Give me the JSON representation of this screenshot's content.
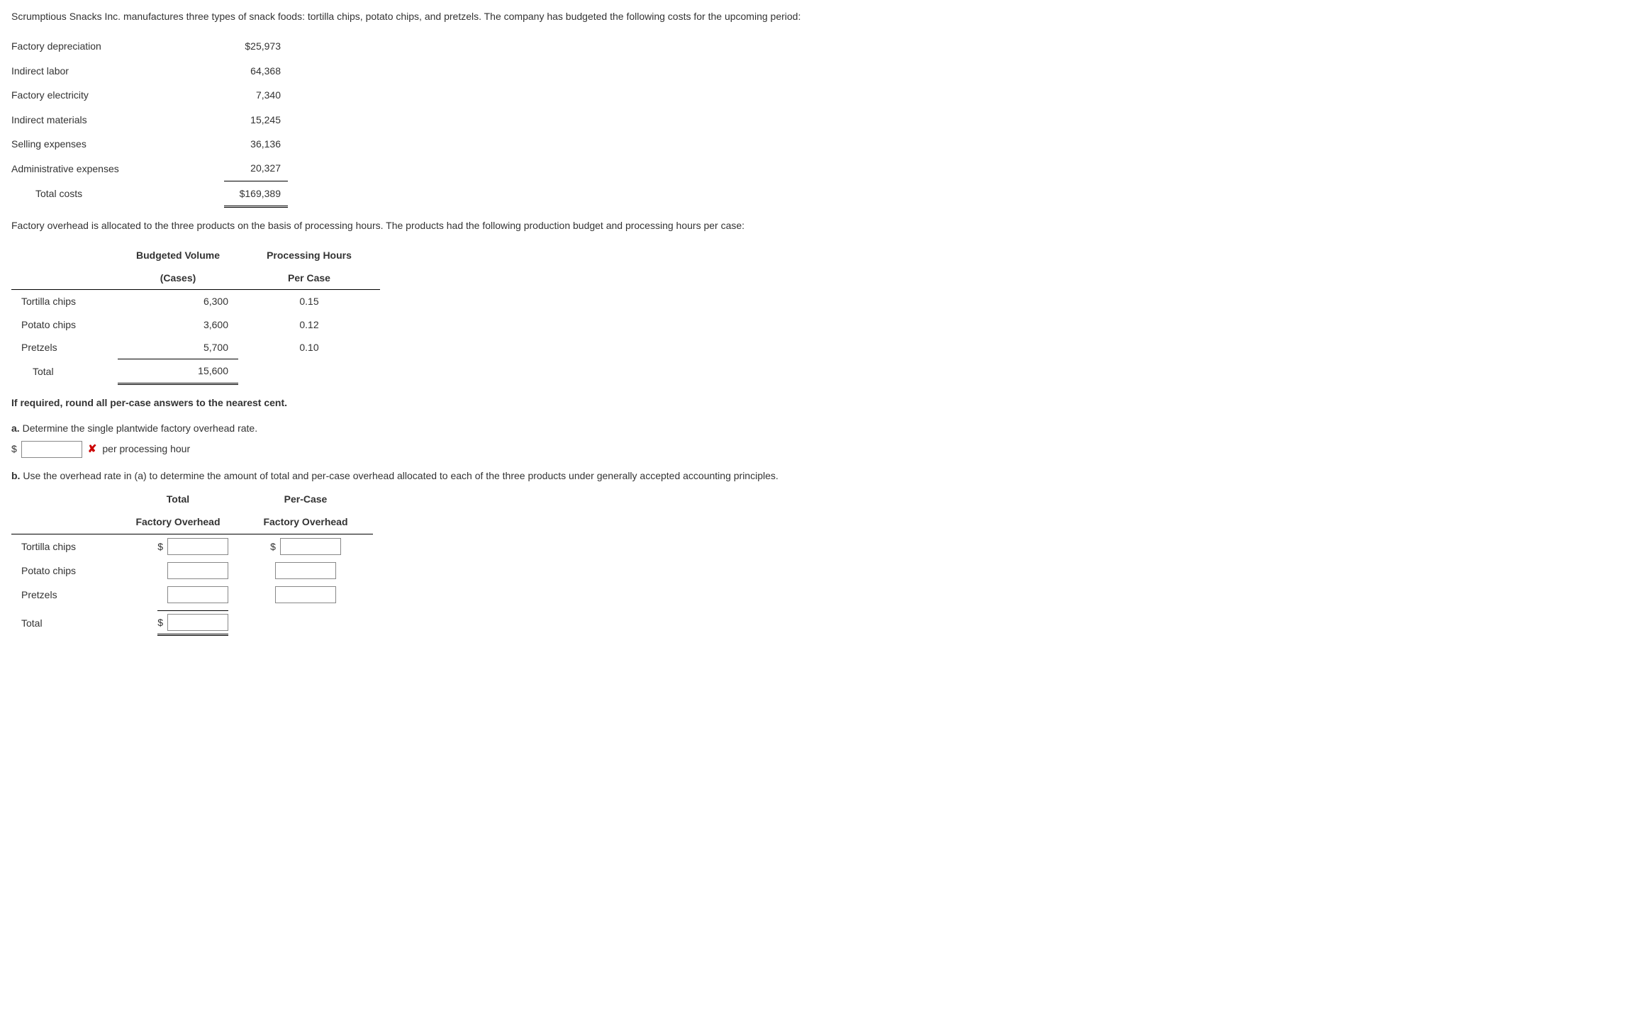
{
  "intro": "Scrumptious Snacks Inc. manufactures three types of snack foods: tortilla chips, potato chips, and pretzels. The company has budgeted the following costs for the upcoming period:",
  "costs": {
    "r1": {
      "label": "Factory depreciation",
      "value": "$25,973"
    },
    "r2": {
      "label": "Indirect labor",
      "value": "64,368"
    },
    "r3": {
      "label": "Factory electricity",
      "value": "7,340"
    },
    "r4": {
      "label": "Indirect materials",
      "value": "15,245"
    },
    "r5": {
      "label": "Selling expenses",
      "value": "36,136"
    },
    "r6": {
      "label": "Administrative expenses",
      "value": "20,327"
    },
    "total": {
      "label": "Total costs",
      "value": "$169,389"
    }
  },
  "para2": "Factory overhead is allocated to the three products on the basis of processing hours. The products had the following production budget and processing hours per case:",
  "vol": {
    "h1a": "Budgeted Volume",
    "h1b": "(Cases)",
    "h2a": "Processing Hours",
    "h2b": "Per Case",
    "r1": {
      "prod": "Tortilla chips",
      "vol": "6,300",
      "hrs": "0.15"
    },
    "r2": {
      "prod": "Potato chips",
      "vol": "3,600",
      "hrs": "0.12"
    },
    "r3": {
      "prod": "Pretzels",
      "vol": "5,700",
      "hrs": "0.10"
    },
    "total": {
      "label": "Total",
      "vol": "15,600"
    }
  },
  "note": "If required, round all per-case answers to the nearest cent.",
  "qa": {
    "tag": "a.",
    "text": "Determine the single plantwide factory overhead rate.",
    "unit": "per processing hour",
    "dollar": "$",
    "wrong": "✘"
  },
  "qb": {
    "tag": "b.",
    "text": "Use the overhead rate in (a) to determine the amount of total and per-case overhead allocated to each of the three products under generally accepted accounting principles.",
    "h1a": "Total",
    "h1b": "Factory Overhead",
    "h2a": "Per-Case",
    "h2b": "Factory Overhead",
    "r1": "Tortilla chips",
    "r2": "Potato chips",
    "r3": "Pretzels",
    "r4": "Total",
    "dollar": "$"
  }
}
